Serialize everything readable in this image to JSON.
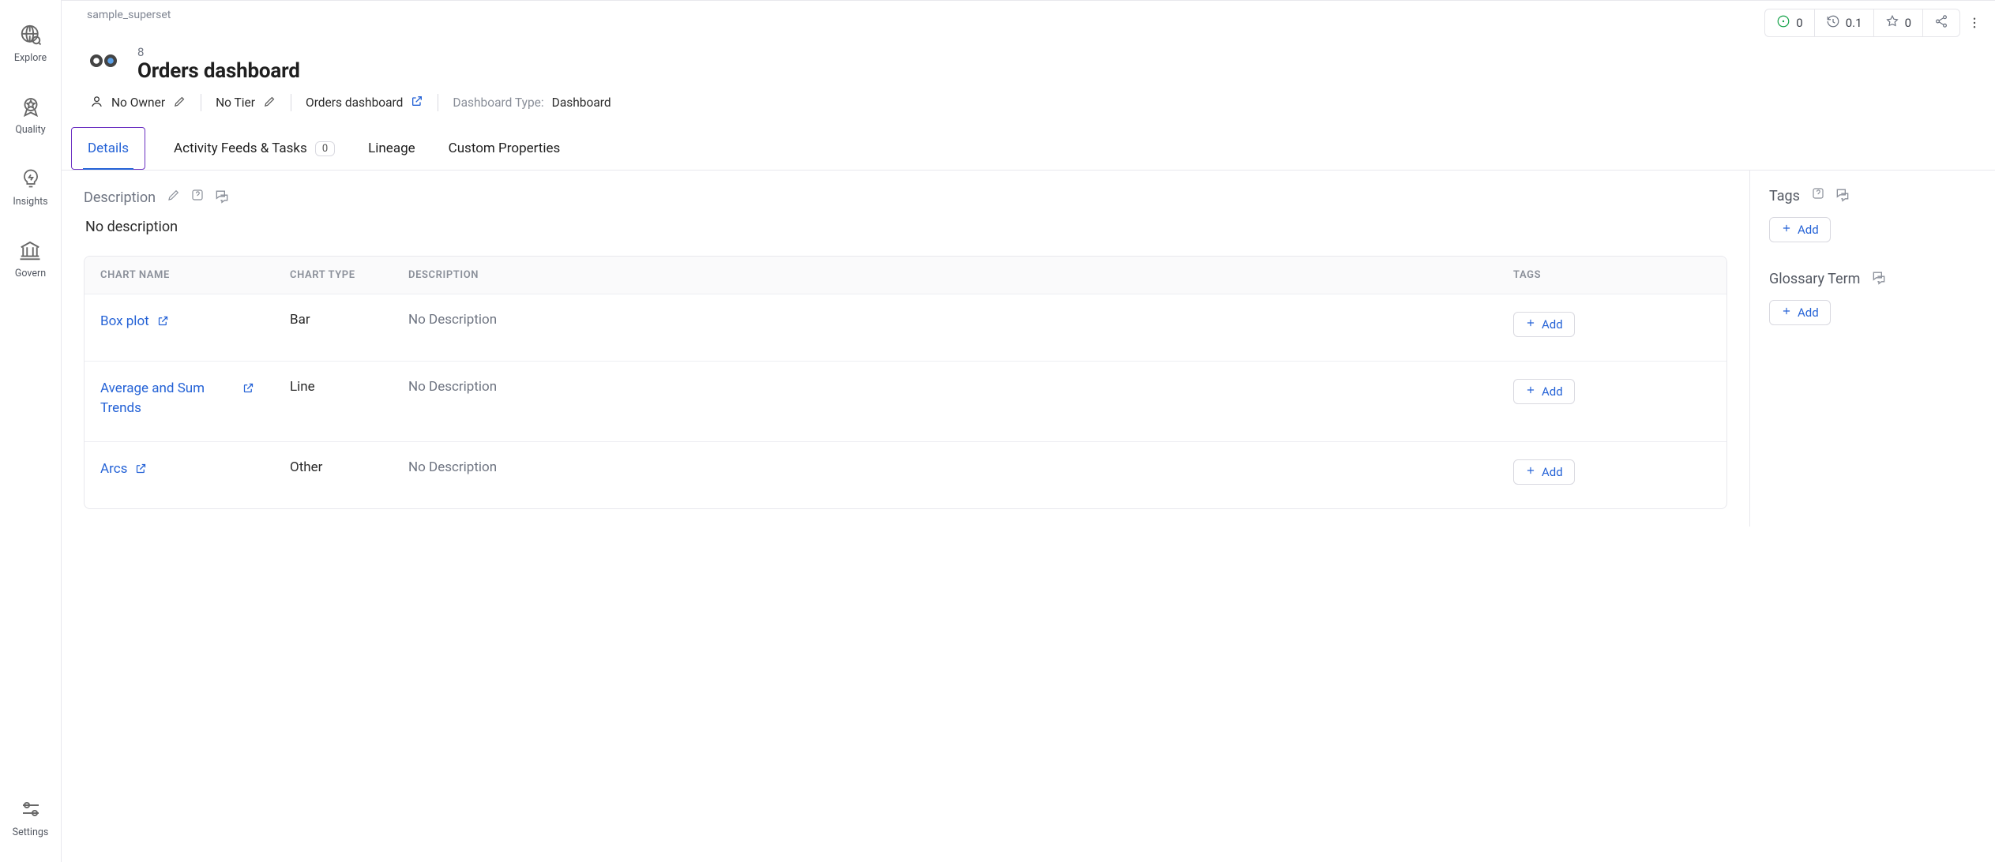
{
  "sidebar": {
    "items": [
      {
        "label": "Explore",
        "icon": "globe-search-icon"
      },
      {
        "label": "Quality",
        "icon": "ribbon-star-icon"
      },
      {
        "label": "Insights",
        "icon": "bulb-icon"
      },
      {
        "label": "Govern",
        "icon": "govern-icon"
      },
      {
        "label": "Settings",
        "icon": "sliders-icon"
      }
    ]
  },
  "top_metrics": {
    "status_count": "0",
    "time_value": "0.1",
    "star_count": "0"
  },
  "breadcrumb": "sample_superset",
  "header": {
    "id": "8",
    "title": "Orders dashboard",
    "owner": "No Owner",
    "tier": "No Tier",
    "link_text": "Orders dashboard",
    "dash_type_label": "Dashboard Type: ",
    "dash_type_value": "Dashboard"
  },
  "tabs": [
    {
      "label": "Details",
      "active": true
    },
    {
      "label": "Activity Feeds & Tasks",
      "count": "0"
    },
    {
      "label": "Lineage"
    },
    {
      "label": "Custom Properties"
    }
  ],
  "details": {
    "section_title": "Description",
    "no_description": "No description",
    "table": {
      "headers": {
        "chart_name": "CHART NAME",
        "chart_type": "CHART TYPE",
        "description": "DESCRIPTION",
        "tags": "TAGS"
      },
      "rows": [
        {
          "name": "Box plot",
          "type": "Bar",
          "desc": "No Description",
          "add": "Add"
        },
        {
          "name": "Average and Sum Trends",
          "type": "Line",
          "desc": "No Description",
          "add": "Add"
        },
        {
          "name": "Arcs",
          "type": "Other",
          "desc": "No Description",
          "add": "Add"
        }
      ]
    }
  },
  "right_panel": {
    "tags": {
      "title": "Tags",
      "add": "Add"
    },
    "glossary": {
      "title": "Glossary Term",
      "add": "Add"
    }
  }
}
